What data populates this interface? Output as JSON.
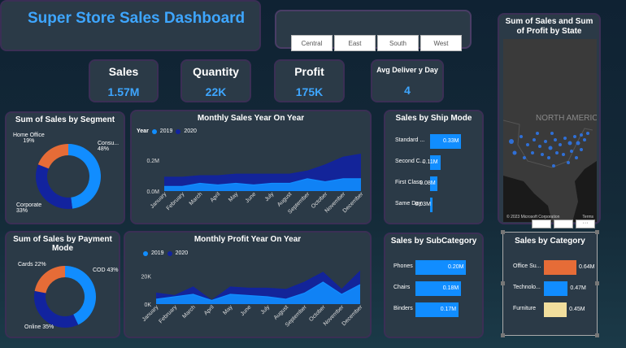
{
  "title": "Super Store Sales Dashboard",
  "regions": [
    "Central",
    "East",
    "South",
    "West"
  ],
  "kpis": [
    {
      "label": "Sales",
      "value": "1.57M"
    },
    {
      "label": "Quantity",
      "value": "22K"
    },
    {
      "label": "Profit",
      "value": "175K"
    },
    {
      "label": "Avg Deliver y Day",
      "value": "4"
    }
  ],
  "map": {
    "title": "Sum of Sales and Sum of Profit by State",
    "region_label": "NORTH AMERICA",
    "credit": "© 2023 Microsoft Corporation",
    "terms": "Terms"
  },
  "segment": {
    "title": "Sum of Sales by Segment",
    "labels": [
      {
        "name": "Home Office",
        "pct": "19%"
      },
      {
        "name": "Consu...",
        "pct": "48%"
      },
      {
        "name": "Corporate",
        "pct": "33%"
      }
    ],
    "slices": [
      {
        "name": "Consumer",
        "value": 48,
        "color": "#118dff"
      },
      {
        "name": "Corporate",
        "value": 33,
        "color": "#12239e"
      },
      {
        "name": "Home Office",
        "value": 19,
        "color": "#e66c37"
      }
    ]
  },
  "payment": {
    "title": "Sum of Sales by Payment Mode",
    "labels": [
      {
        "name": "Cards",
        "pct": "22%"
      },
      {
        "name": "COD",
        "pct": "43%"
      },
      {
        "name": "Online",
        "pct": "35%"
      }
    ],
    "slices": [
      {
        "name": "COD",
        "value": 43,
        "color": "#118dff"
      },
      {
        "name": "Online",
        "value": 35,
        "color": "#12239e"
      },
      {
        "name": "Cards",
        "value": 22,
        "color": "#e66c37"
      }
    ]
  },
  "legend": {
    "year_label": "Year",
    "y2019": "2019",
    "y2020": "2020",
    "c2019": "#118dff",
    "c2020": "#12239e"
  },
  "months": [
    "January",
    "February",
    "March",
    "April",
    "May",
    "June",
    "July",
    "August",
    "September",
    "October",
    "November",
    "December"
  ],
  "chart_data": [
    {
      "type": "area",
      "title": "Monthly Sales Year On Year",
      "categories": [
        "January",
        "February",
        "March",
        "April",
        "May",
        "June",
        "July",
        "August",
        "September",
        "October",
        "November",
        "December"
      ],
      "y_ticks": [
        "0.2M",
        "0.0M"
      ],
      "ylim": [
        0,
        0.28
      ],
      "series": [
        {
          "name": "2019",
          "values": [
            0.03,
            0.03,
            0.05,
            0.04,
            0.05,
            0.04,
            0.05,
            0.05,
            0.08,
            0.06,
            0.08,
            0.08
          ]
        },
        {
          "name": "2020",
          "values": [
            0.09,
            0.09,
            0.1,
            0.1,
            0.11,
            0.11,
            0.11,
            0.11,
            0.13,
            0.17,
            0.22,
            0.24
          ]
        }
      ]
    },
    {
      "type": "area",
      "title": "Monthly Profit Year On Year",
      "categories": [
        "January",
        "February",
        "March",
        "April",
        "May",
        "June",
        "July",
        "August",
        "September",
        "October",
        "November",
        "December"
      ],
      "y_ticks": [
        "20K",
        "0K"
      ],
      "ylim": [
        0,
        32
      ],
      "series": [
        {
          "name": "2019",
          "values": [
            4,
            6,
            8,
            3,
            8,
            7,
            6,
            4,
            9,
            18,
            8,
            16
          ]
        },
        {
          "name": "2020",
          "values": [
            9,
            7,
            14,
            3,
            14,
            13,
            13,
            12,
            18,
            26,
            12,
            27
          ]
        }
      ]
    },
    {
      "type": "bar",
      "title": "Sales by Ship Mode",
      "categories": [
        "Standard ...",
        "Second C...",
        "First Class",
        "Same Day"
      ],
      "values": [
        0.33,
        0.11,
        0.08,
        0.03
      ],
      "labels": [
        "0.33M",
        "0.11M",
        "0.08M",
        "0.03M"
      ],
      "colors": [
        "#118dff",
        "#118dff",
        "#118dff",
        "#118dff"
      ]
    },
    {
      "type": "bar",
      "title": "Sales by SubCategory",
      "categories": [
        "Phones",
        "Chairs",
        "Binders"
      ],
      "values": [
        0.2,
        0.18,
        0.17
      ],
      "labels": [
        "0.20M",
        "0.18M",
        "0.17M"
      ],
      "colors": [
        "#118dff",
        "#118dff",
        "#118dff"
      ]
    },
    {
      "type": "bar",
      "title": "Sales by Category",
      "categories": [
        "Office Su...",
        "Technolo...",
        "Furniture"
      ],
      "values": [
        0.64,
        0.47,
        0.45
      ],
      "labels": [
        "0.64M",
        "0.47M",
        "0.45M"
      ],
      "colors": [
        "#e66c37",
        "#118dff",
        "#f1de9d"
      ]
    }
  ]
}
